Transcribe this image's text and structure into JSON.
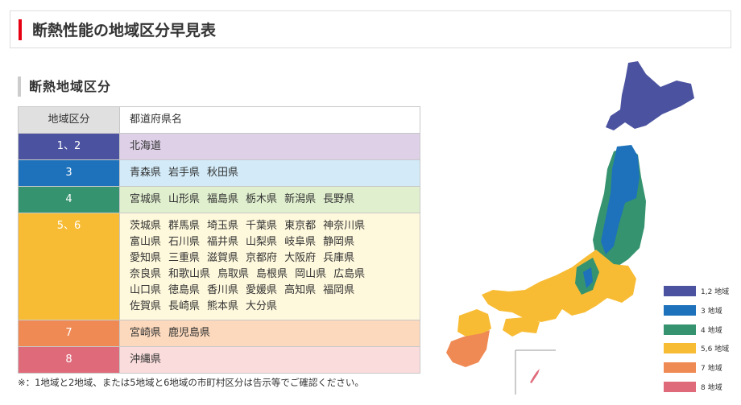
{
  "title": "断熱性能の地域区分早見表",
  "subtitle": "断熱地域区分",
  "table": {
    "headers": [
      "地域区分",
      "都道府県名"
    ],
    "rows": [
      {
        "zone": "1、2",
        "key_color": "#4b53a0",
        "bg": "#ddd0e7",
        "prefs": [
          "北海道"
        ]
      },
      {
        "zone": "3",
        "key_color": "#1d72bb",
        "bg": "#d3ebf8",
        "prefs": [
          "青森県",
          "岩手県",
          "秋田県"
        ]
      },
      {
        "zone": "4",
        "key_color": "#35936f",
        "bg": "#e0efce",
        "prefs": [
          "宮城県",
          "山形県",
          "福島県",
          "栃木県",
          "新潟県",
          "長野県"
        ]
      },
      {
        "zone": "5、6",
        "key_color": "#f8bc34",
        "bg": "#fef8dc",
        "prefs": [
          "茨城県",
          "群馬県",
          "埼玉県",
          "千葉県",
          "東京都",
          "神奈川県",
          "富山県",
          "石川県",
          "福井県",
          "山梨県",
          "岐阜県",
          "静岡県",
          "愛知県",
          "三重県",
          "滋賀県",
          "京都府",
          "大阪府",
          "兵庫県",
          "奈良県",
          "和歌山県",
          "鳥取県",
          "島根県",
          "岡山県",
          "広島県",
          "山口県",
          "徳島県",
          "香川県",
          "愛媛県",
          "高知県",
          "福岡県",
          "佐賀県",
          "長崎県",
          "熊本県",
          "大分県"
        ]
      },
      {
        "zone": "7",
        "key_color": "#f08a55",
        "bg": "#fcd9bd",
        "prefs": [
          "宮崎県",
          "鹿児島県"
        ]
      },
      {
        "zone": "8",
        "key_color": "#df6a7a",
        "bg": "#fadcdc",
        "prefs": [
          "沖縄県"
        ]
      }
    ]
  },
  "note": "※：1地域と2地域、または5地域と6地域の市町村区分は告示等でご確認ください。",
  "legend": [
    {
      "label": "1,2 地域",
      "color": "#4b53a0"
    },
    {
      "label": "3 地域",
      "color": "#1d72bb"
    },
    {
      "label": "4 地域",
      "color": "#35936f"
    },
    {
      "label": "5,6 地域",
      "color": "#f8bc34"
    },
    {
      "label": "7 地域",
      "color": "#f08a55"
    },
    {
      "label": "8 地域",
      "color": "#df6a7a"
    }
  ]
}
